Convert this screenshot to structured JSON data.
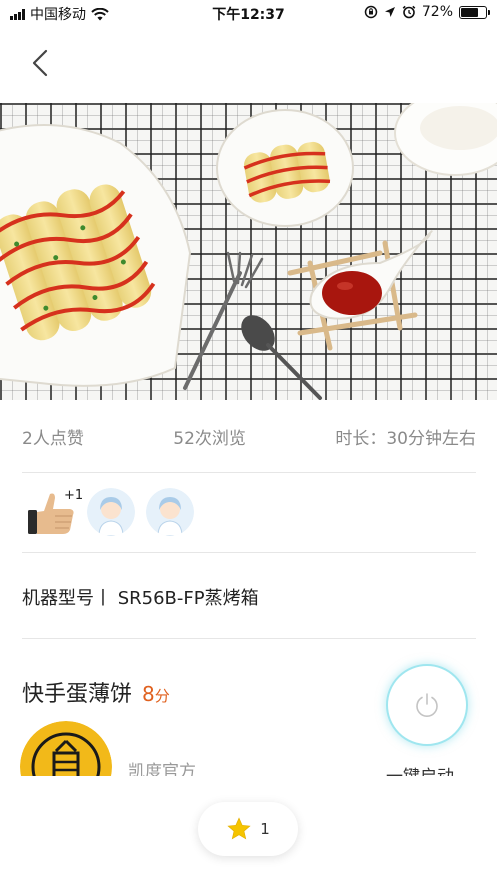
{
  "status_bar": {
    "carrier": "中国移动",
    "time": "下午12:37",
    "battery": "72%",
    "battery_level": 0.72
  },
  "stats": {
    "likes": "2人点赞",
    "views": "52次浏览",
    "duration": "时长：30分钟左右"
  },
  "likers": {
    "badge": "+1"
  },
  "machine": {
    "model": "机器型号丨 SR56B-FP蒸烤箱"
  },
  "recipe": {
    "title": "快手蛋薄饼",
    "score": "8",
    "score_unit": "分"
  },
  "author": {
    "name": "凯度官方"
  },
  "action": {
    "start_label": "一键启动"
  },
  "favorites": {
    "count": "1"
  },
  "colors": {
    "accent_orange": "#e0611f",
    "power_ring": "#9fe6ef",
    "star": "#f5c400",
    "logo_yellow": "#f2b919"
  },
  "icons": [
    "back-icon",
    "wifi-icon",
    "lock-rotation-icon",
    "location-icon",
    "alarm-icon",
    "battery-icon",
    "thumbs-up-icon",
    "user-avatar-icon",
    "power-icon",
    "star-icon"
  ]
}
